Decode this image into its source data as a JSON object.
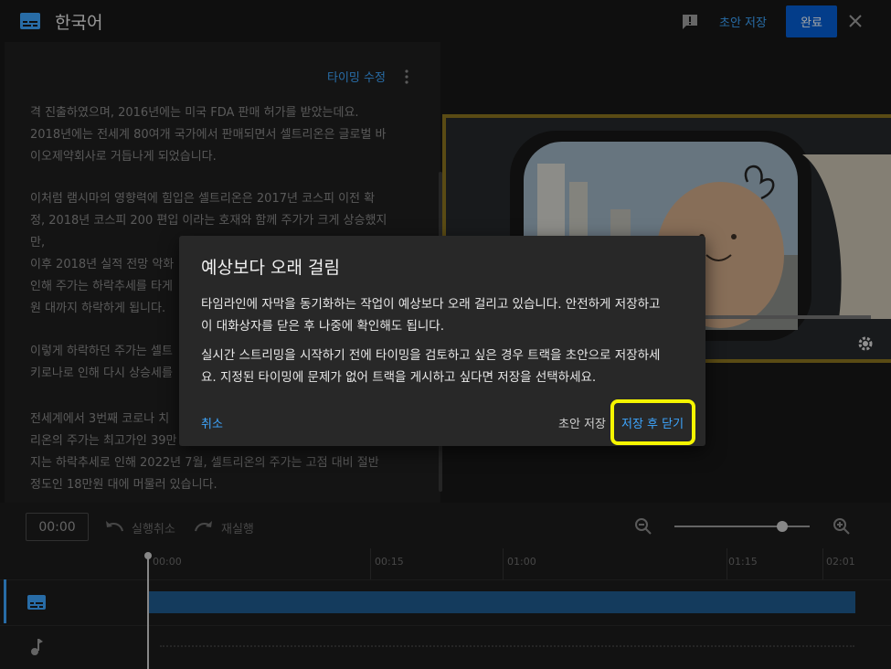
{
  "header": {
    "title": "한국어",
    "draft_save": "초안 저장",
    "done": "완료"
  },
  "editor": {
    "timing_edit": "타이밍 수정",
    "paragraphs": [
      [
        "격 진출하였으며, 2016년에는 미국 FDA 판매 허가를 받았는데요.",
        "2018년에는 전세계 80여개 국가에서 판매되면서 셀트리온은 글로벌 바",
        "이오제약회사로 거듭나게 되었습니다."
      ],
      [
        "이처럼 램시마의 영향력에 힘입은 셀트리온은 2017년 코스피 이전 확",
        "정, 2018년 코스피 200 편입 이라는 호재와 함께 주가가 크게 상승했지",
        "만,",
        "이후 2018년 실적 전망 악화",
        "인해 주가는 하락추세를 타게",
        "원 대까지 하락하게 됩니다."
      ],
      [
        "이렇게 하락하던 주가는 셀트",
        "키로나로 인해 다시 상승세를"
      ],
      [
        "전세계에서 3번째 코로나 치",
        "리온의 주가는 최고가인 39만",
        "지는 하락추세로 인해 2022년 7월, 셀트리온의 주가는 고점 대비 절반",
        "정도인 18만원 대에 머물러 있습니다."
      ]
    ]
  },
  "timeline": {
    "current_time": "00:00",
    "undo": "실행취소",
    "redo": "재실행",
    "zoom_level": 0.82,
    "ruler": [
      "00:00",
      "00:15",
      "01:00",
      "01:15",
      "02:01"
    ]
  },
  "dialog": {
    "title": "예상보다 오래 걸림",
    "line1a": "타임라인에 자막을 동기화하는 작업이 예상보다 오래 걸리고 있습니다. 안전하게 저장하고",
    "line1b": "이 대화상자를 닫은 후 나중에 확인해도 됩니다.",
    "line2a": "실시간 스트리밍을 시작하기 전에 타이밍을 검토하고 싶은 경우 트랙을 초안으로 저장하세",
    "line2b": "요. 지정된 타이밍에 문제가 없어 트랙을 게시하고 싶다면 저장을 선택하세요.",
    "cancel": "취소",
    "save_draft": "초안 저장",
    "save_close": "저장 후 닫기"
  },
  "colors": {
    "accent": "#3ea6ff",
    "primary_button": "#065fd4",
    "highlight": "#f5f500"
  }
}
